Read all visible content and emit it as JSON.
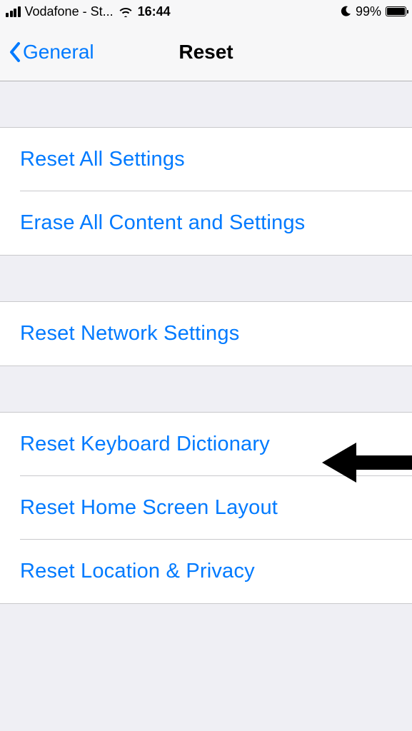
{
  "status": {
    "carrier": "Vodafone - St...",
    "time": "16:44",
    "battery_pct": "99%"
  },
  "nav": {
    "back_label": "General",
    "title": "Reset"
  },
  "sections": [
    {
      "rows": [
        {
          "label": "Reset All Settings"
        },
        {
          "label": "Erase All Content and Settings"
        }
      ]
    },
    {
      "rows": [
        {
          "label": "Reset Network Settings"
        }
      ]
    },
    {
      "rows": [
        {
          "label": "Reset Keyboard Dictionary"
        },
        {
          "label": "Reset Home Screen Layout"
        },
        {
          "label": "Reset Location & Privacy"
        }
      ]
    }
  ]
}
